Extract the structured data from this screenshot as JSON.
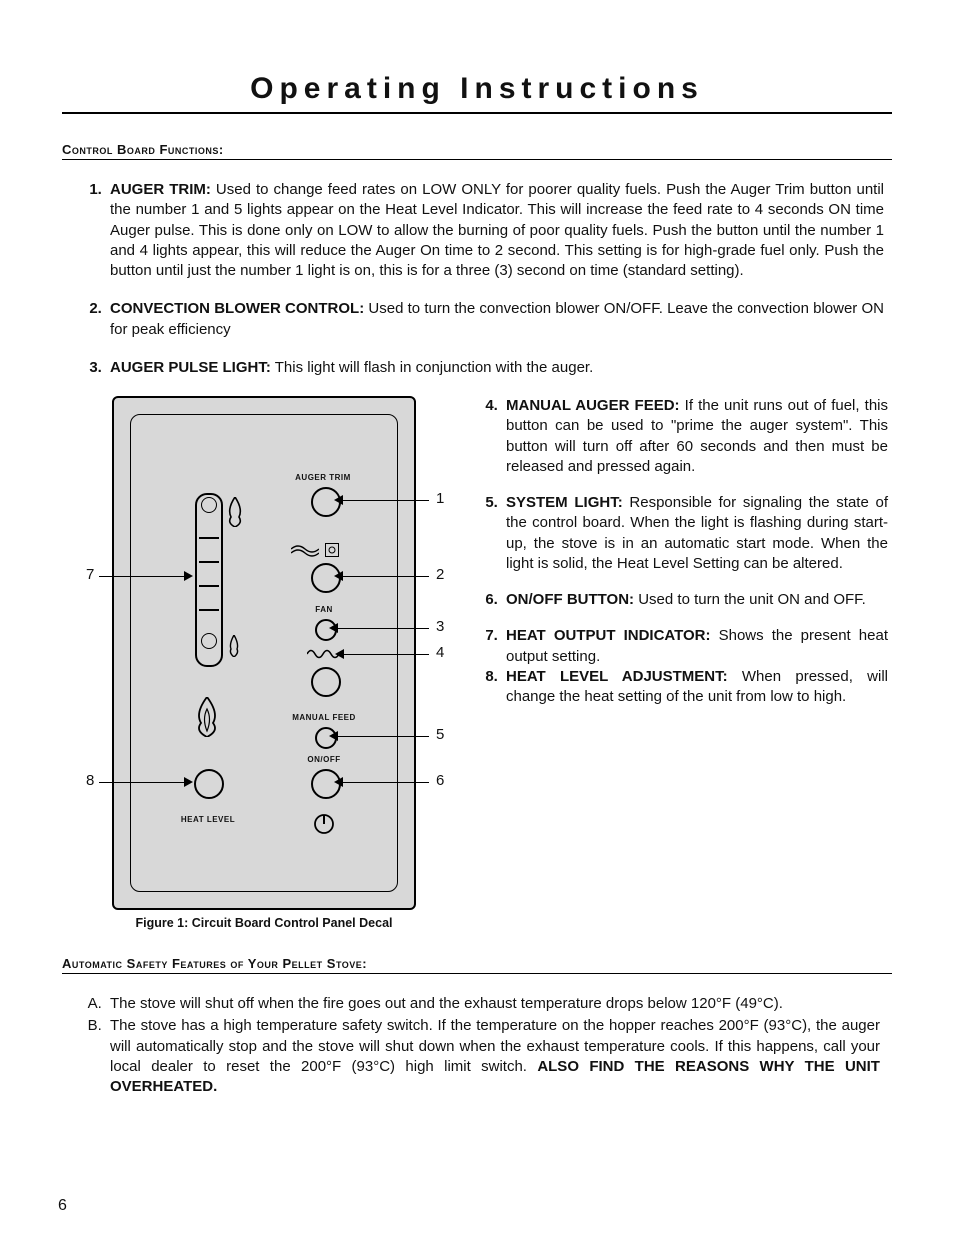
{
  "page": {
    "number": "6",
    "title": "Operating Instructions"
  },
  "section1": {
    "heading": "Control Board Functions:"
  },
  "items": {
    "i1": {
      "term": "AUGER TRIM:",
      "body": " Used to change feed rates on LOW ONLY for poorer quality fuels. Push the Auger Trim button until the number 1 and 5 lights appear on the Heat Level Indicator.  This will increase the feed rate to 4 seconds ON time Auger pulse.  This is done only on LOW to allow the burning of poor quality fuels.  Push the button until the number 1 and 4 lights appear, this will reduce the Auger On time to 2 second.  This setting is for high-grade fuel only.  Push the button until just the number 1 light is on, this is for a three (3) second on time (standard setting)."
    },
    "i2": {
      "term": "CONVECTION BLOWER CONTROL:",
      "body": " Used to turn the convection blower ON/OFF. Leave the convection blower ON for peak efficiency"
    },
    "i3": {
      "term": "AUGER PULSE LIGHT:",
      "body": " This light will flash in conjunction with the auger."
    },
    "i4": {
      "term": "MANUAL AUGER FEED:",
      "body": " If the unit runs out of fuel, this button can be used to \"prime the auger system\". This button will turn off after 60 seconds and then must be released and pressed again."
    },
    "i5": {
      "term": "SYSTEM LIGHT:",
      "body": " Responsible for signaling the state of the control board. When the light is flashing during start-up, the stove is in an automatic start mode. When the light is solid, the Heat Level Setting can be altered."
    },
    "i6": {
      "term": "ON/OFF BUTTON:",
      "body": " Used to turn the unit ON and OFF."
    },
    "i7": {
      "term": "HEAT OUTPUT INDICATOR:",
      "body": " Shows the present heat output setting."
    },
    "i8": {
      "term": "HEAT LEVEL ADJUSTMENT:",
      "body": " When pressed, will change the heat setting of the unit from low to high."
    }
  },
  "figure": {
    "caption": "Figure 1: Circuit Board Control Panel Decal",
    "labels": {
      "auger_trim": "AUGER TRIM",
      "fan": "FAN",
      "manual_feed": "MANUAL FEED",
      "onoff": "ON/OFF",
      "heat_level": "HEAT LEVEL"
    },
    "callouts": {
      "c1": "1",
      "c2": "2",
      "c3": "3",
      "c4": "4",
      "c5": "5",
      "c6": "6",
      "c7": "7",
      "c8": "8"
    }
  },
  "section2": {
    "heading": "Automatic Safety Features of Your Pellet Stove:"
  },
  "safety": {
    "a": "The stove will shut off when the fire goes out and the exhaust temperature drops below 120°F (49°C).",
    "b1": "The stove has a high temperature safety switch.  If the temperature on the hopper reaches 200°F (93°C), the auger will automatically stop and the stove will shut down when the exhaust temperature cools.  If this happens, call your local dealer to reset the 200°F (93°C) high limit switch. ",
    "b2": "ALSO FIND THE REASONS WHY THE UNIT OVERHEATED."
  }
}
